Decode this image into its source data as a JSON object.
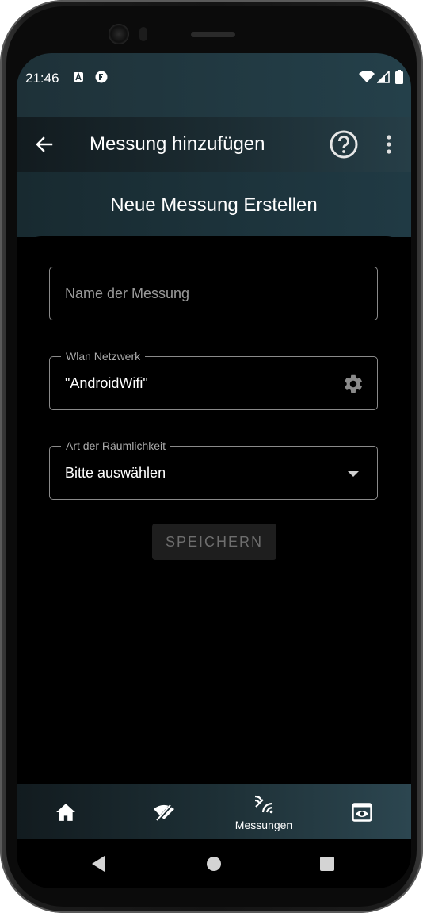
{
  "status": {
    "time": "21:46",
    "left_icons": [
      "a-box-icon",
      "f-circle-icon"
    ],
    "right_icons": [
      "wifi-icon",
      "signal-icon",
      "battery-icon"
    ]
  },
  "appbar": {
    "back_icon": "arrow-left-icon",
    "title": "Messung hinzufügen",
    "help_icon": "help-circle-icon",
    "menu_icon": "more-vertical-icon"
  },
  "subheader": {
    "title": "Neue Messung Erstellen"
  },
  "form": {
    "name_field": {
      "placeholder": "Name der Messung",
      "value": ""
    },
    "wlan_field": {
      "label": "Wlan Netzwerk",
      "value": "\"AndroidWifi\"",
      "icon": "gear-icon"
    },
    "room_field": {
      "label": "Art der Räumlichkeit",
      "value": "Bitte auswählen",
      "icon": "dropdown-arrow-icon"
    },
    "save_label": "SPEICHERN"
  },
  "bottom_nav": {
    "items": [
      {
        "icon": "home-icon",
        "label": ""
      },
      {
        "icon": "wifi-off-icon",
        "label": ""
      },
      {
        "icon": "measurements-icon",
        "label": "Messungen",
        "selected": true
      },
      {
        "icon": "eye-box-icon",
        "label": ""
      }
    ]
  },
  "colors": {
    "accent_dark": "#121b1f",
    "accent_teal": "#263e47",
    "background": "#000000",
    "text": "#ffffff"
  }
}
